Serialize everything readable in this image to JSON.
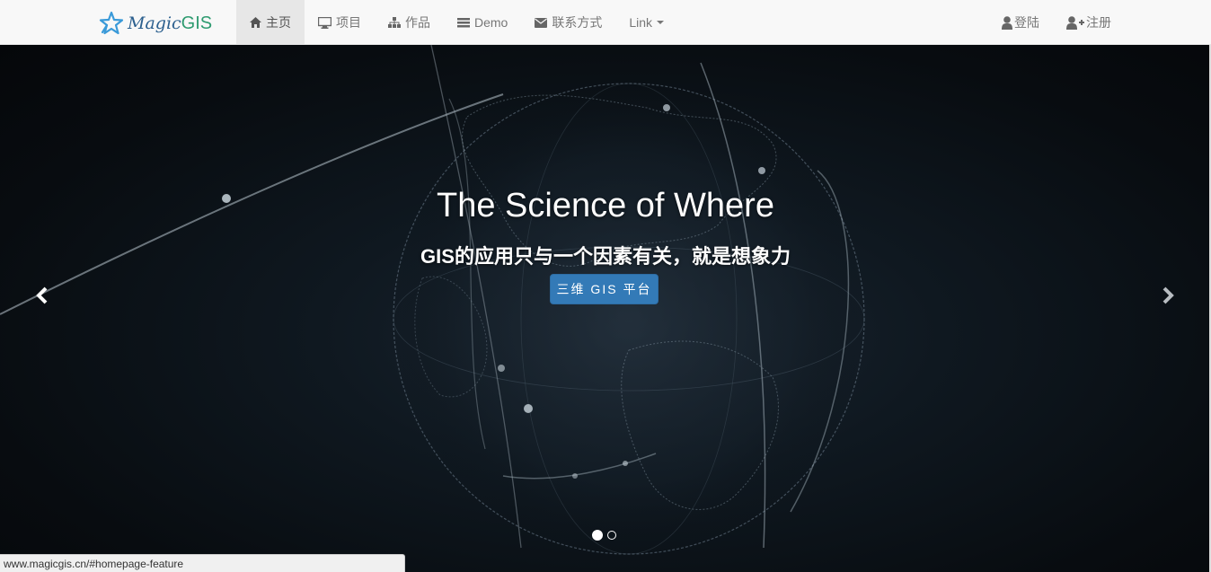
{
  "brand": {
    "name_part1": "Magic",
    "name_part2": "GIS"
  },
  "nav": {
    "home": "主页",
    "projects": "项目",
    "works": "作品",
    "demo": "Demo",
    "contact": "联系方式",
    "link": "Link",
    "login": "登陆",
    "register": "注册"
  },
  "hero": {
    "title": "The Science of Where",
    "subtitle": "GIS的应用只与一个因素有关，就是想象力",
    "button": "三维 GIS 平台"
  },
  "carousel": {
    "active_index": 0,
    "count": 2
  },
  "status_bar": {
    "url": "www.magicgis.cn/#homepage-feature"
  },
  "colors": {
    "accent": "#337ab7",
    "navbar_bg": "#f8f8f8",
    "brand_blue": "#2b5f8e",
    "brand_green": "#2e9b70"
  }
}
